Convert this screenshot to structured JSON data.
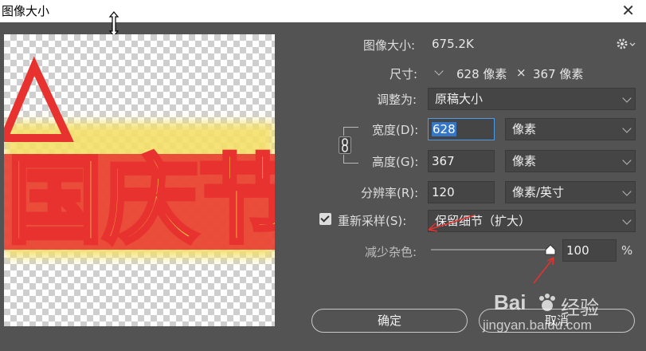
{
  "window": {
    "title": "图像大小",
    "close_glyph": "✕"
  },
  "info": {
    "size_label": "图像大小:",
    "size_value": "675.2K",
    "dims_label": "尺寸:",
    "dims_width": "628 像素",
    "dims_times": "×",
    "dims_height": "367 像素"
  },
  "adjust": {
    "label": "调整为:",
    "value": "原稿大小"
  },
  "width": {
    "label": "宽度(D):",
    "value": "628",
    "unit": "像素"
  },
  "height": {
    "label": "高度(G):",
    "value": "367",
    "unit": "像素"
  },
  "resolution": {
    "label": "分辨率(R):",
    "value": "120",
    "unit": "像素/英寸"
  },
  "resample": {
    "label": "重新采样(S):",
    "checked": true,
    "value": "保留细节（扩大）"
  },
  "noise": {
    "label": "减少杂色:",
    "value": "100",
    "unit": "%",
    "level": 1.0
  },
  "buttons": {
    "ok": "确定",
    "cancel": "取消"
  },
  "preview": {
    "text": "国庆节"
  },
  "watermark": {
    "brand": "Bai",
    "brand2": "经验",
    "url": "jingyan.baidu.com"
  },
  "colors": {
    "dialog_bg": "#535353",
    "field_bg": "#454545",
    "accent": "#3477c8",
    "art_red": "#e8322f",
    "art_yellow": "#f7d84a"
  }
}
